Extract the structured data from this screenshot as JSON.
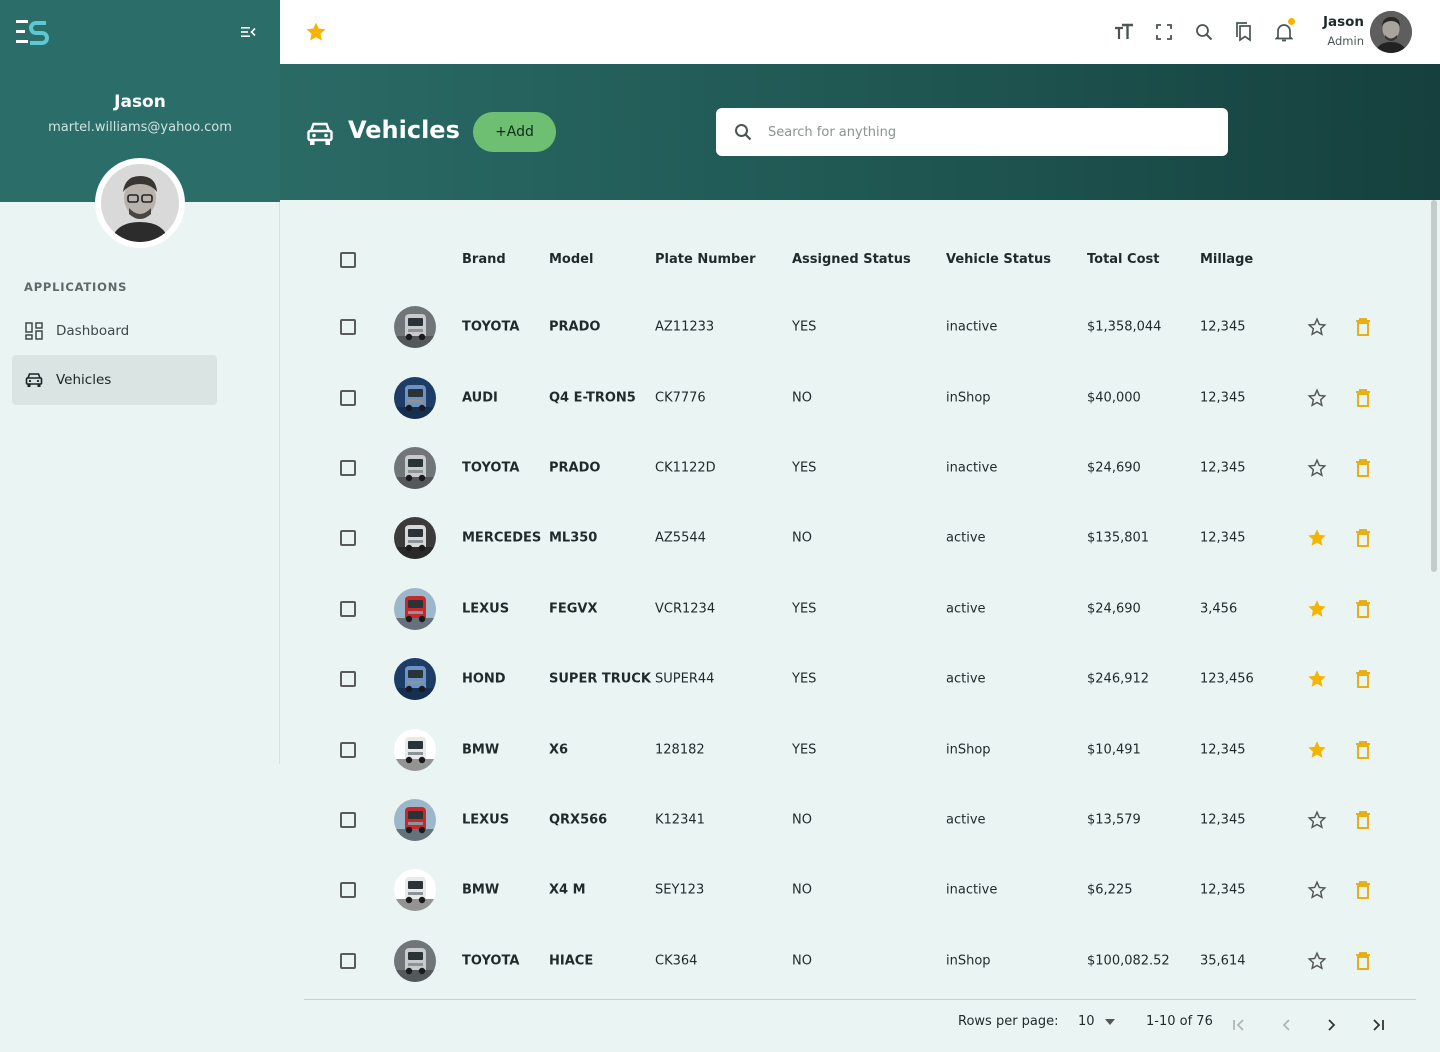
{
  "app": {
    "logo": "ES"
  },
  "sidebar": {
    "user_name": "Jason",
    "user_email": "martel.williams@yahoo.com",
    "section_label": "APPLICATIONS",
    "items": [
      {
        "label": "Dashboard",
        "icon": "dashboard-icon",
        "active": false
      },
      {
        "label": "Vehicles",
        "icon": "car-icon",
        "active": true
      }
    ]
  },
  "topbar": {
    "user_name": "Jason",
    "user_role": "Admin",
    "icons": [
      "text-size-icon",
      "fullscreen-icon",
      "search-icon",
      "bookmarks-icon",
      "bell-icon"
    ],
    "notification_dot_color": "#f4b400"
  },
  "page": {
    "title": "Vehicles",
    "add_label": "+Add",
    "search_placeholder": "Search for anything"
  },
  "table": {
    "columns": [
      "Brand",
      "Model",
      "Plate Number",
      "Assigned Status",
      "Vehicle Status",
      "Total Cost",
      "Millage"
    ],
    "rows": [
      {
        "image": "truck-silver",
        "brand": "TOYOTA",
        "model": "PRADO",
        "plate": "AZ11233",
        "assigned": "YES",
        "status": "inactive",
        "cost": "$1,358,044",
        "millage": "12,345",
        "favorite": false
      },
      {
        "image": "truck-blue",
        "brand": "AUDI",
        "model": "Q4 E-TRON5",
        "plate": "CK7776",
        "assigned": "NO",
        "status": "inShop",
        "cost": "$40,000",
        "millage": "12,345",
        "favorite": false
      },
      {
        "image": "truck-silver",
        "brand": "TOYOTA",
        "model": "PRADO",
        "plate": "CK1122D",
        "assigned": "YES",
        "status": "inactive",
        "cost": "$24,690",
        "millage": "12,345",
        "favorite": false
      },
      {
        "image": "truck-dark",
        "brand": "MERCEDES",
        "model": "ML350",
        "plate": "AZ5544",
        "assigned": "NO",
        "status": "active",
        "cost": "$135,801",
        "millage": "12,345",
        "favorite": true
      },
      {
        "image": "truck-red",
        "brand": "LEXUS",
        "model": "FEGVX",
        "plate": "VCR1234",
        "assigned": "YES",
        "status": "active",
        "cost": "$24,690",
        "millage": "3,456",
        "favorite": true
      },
      {
        "image": "truck-blue",
        "brand": "HOND",
        "model": "SUPER TRUCK",
        "plate": "SUPER44",
        "assigned": "YES",
        "status": "active",
        "cost": "$246,912",
        "millage": "123,456",
        "favorite": true
      },
      {
        "image": "truck-white",
        "brand": "BMW",
        "model": "X6",
        "plate": "128182",
        "assigned": "YES",
        "status": "inShop",
        "cost": "$10,491",
        "millage": "12,345",
        "favorite": true
      },
      {
        "image": "truck-red",
        "brand": "LEXUS",
        "model": "QRX566",
        "plate": "K12341",
        "assigned": "NO",
        "status": "active",
        "cost": "$13,579",
        "millage": "12,345",
        "favorite": false
      },
      {
        "image": "truck-white",
        "brand": "BMW",
        "model": "X4 M",
        "plate": "SEY123",
        "assigned": "NO",
        "status": "inactive",
        "cost": "$6,225",
        "millage": "12,345",
        "favorite": false
      },
      {
        "image": "truck-silver",
        "brand": "TOYOTA",
        "model": "HIACE",
        "plate": "CK364",
        "assigned": "NO",
        "status": "inShop",
        "cost": "$100,082.52",
        "millage": "35,614",
        "favorite": false
      }
    ]
  },
  "pagination": {
    "rows_per_page_label": "Rows per page:",
    "rows_per_page": "10",
    "range_label": "1-10 of 76"
  },
  "colors": {
    "brand_teal": "#2b6e69",
    "accent_green": "#6fbf73",
    "star_gold": "#f4b400",
    "delete_gold": "#e8a800"
  }
}
